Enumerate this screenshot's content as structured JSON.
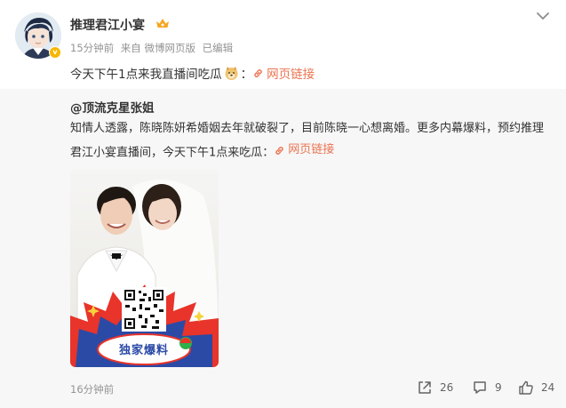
{
  "post": {
    "author": "推理君江小宴",
    "time": "15分钟前",
    "source": "来自 微博网页版",
    "edited": "已编辑",
    "text": "今天下午1点来我直播间吃瓜",
    "colon": "：",
    "link_label": "网页链接"
  },
  "repost": {
    "author": "@顶流克星张姐",
    "text": "知情人透露，陈晓陈妍希婚姻去年就破裂了，目前陈晓一心想离婚。更多内幕爆料，预约推理君江小宴直播间，今天下午1点来吃瓜：",
    "link_label": "网页链接",
    "image_banner": "独家爆料",
    "time": "16分钟前",
    "forward_count": "26",
    "comment_count": "9",
    "like_count": "24"
  },
  "icons": {
    "menu": "chevron-down-icon",
    "link": "link-icon",
    "forward": "forward-icon",
    "comment": "comment-icon",
    "like": "thumbs-up-icon"
  },
  "colors": {
    "link": "#eb7350",
    "meta": "#939393",
    "repost_bg": "#f7f7f7",
    "verified": "#f7b600"
  }
}
